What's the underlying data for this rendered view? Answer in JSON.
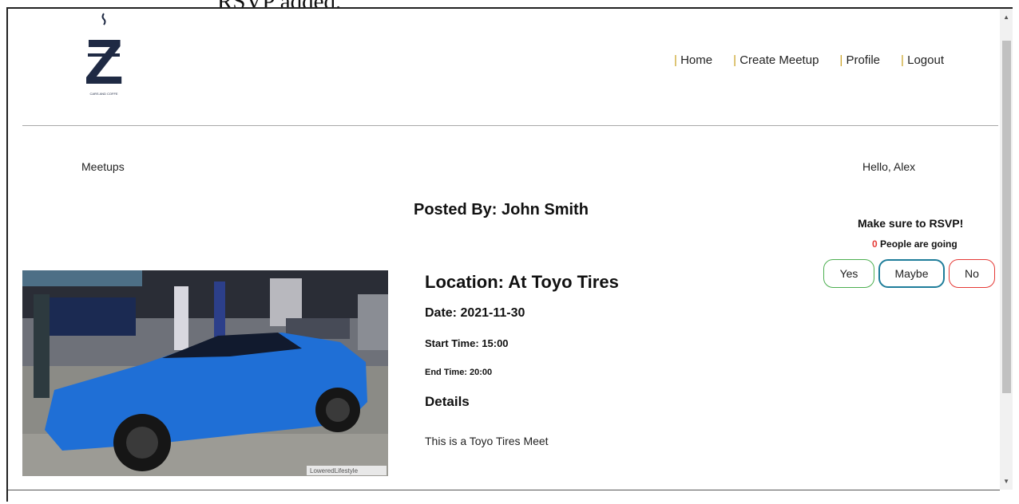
{
  "caption": "RSVP added.",
  "logo": {
    "letter": "Z",
    "tagline": "CARS AND COFFE"
  },
  "nav": [
    {
      "label": "Home"
    },
    {
      "label": "Create Meetup"
    },
    {
      "label": "Profile"
    },
    {
      "label": "Logout"
    }
  ],
  "nav_separator": "|",
  "page": {
    "section_label": "Meetups",
    "greeting": "Hello, Alex"
  },
  "meetup": {
    "posted_by": "Posted By: John Smith",
    "location": "Location: At Toyo Tires",
    "date": "Date: 2021-11-30",
    "start_time": "Start Time: 15:00",
    "end_time": "End Time: 20:00",
    "details_heading": "Details",
    "details": "This is a Toyo Tires Meet",
    "photo_watermark": "LoweredLifestyle"
  },
  "rsvp": {
    "title": "Make sure to RSVP!",
    "count": "0",
    "going_text": "People are going",
    "buttons": {
      "yes": "Yes",
      "maybe": "Maybe",
      "no": "No"
    }
  },
  "colors": {
    "nav_separator": "#c9a020",
    "yes": "#4caf50",
    "maybe": "#1e7d9a",
    "no": "#e53935",
    "logo": "#1f2a44"
  }
}
